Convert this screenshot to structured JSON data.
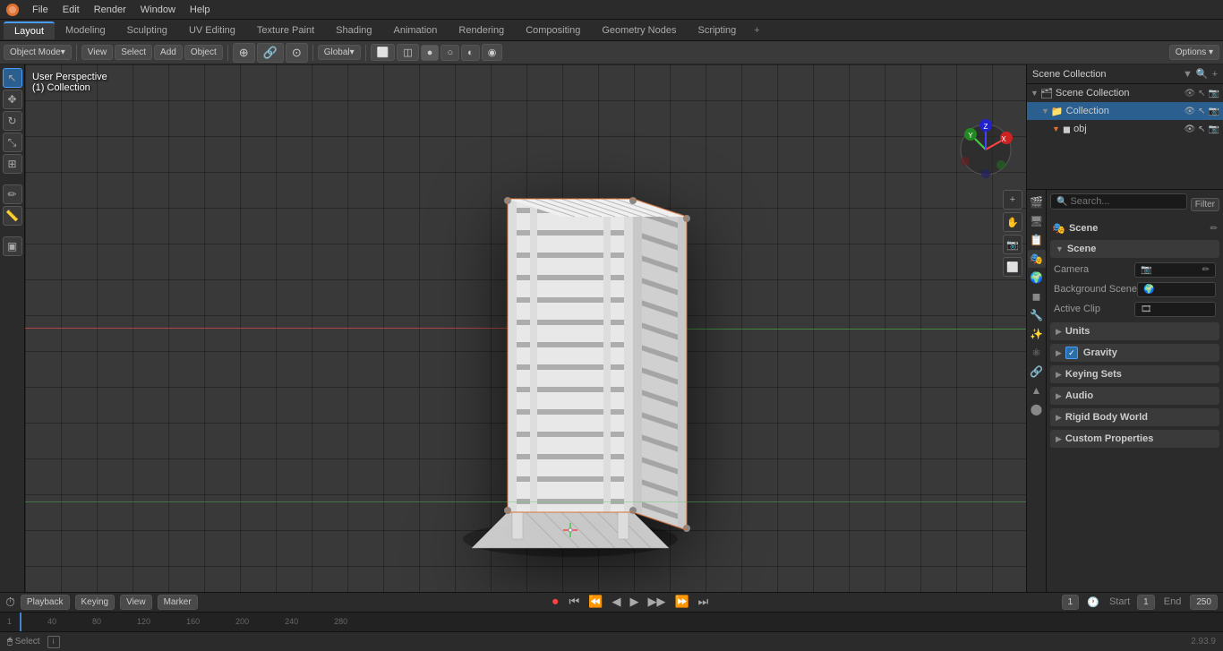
{
  "app": {
    "title": "Blender",
    "version": "2.93.9"
  },
  "top_menu": {
    "items": [
      "File",
      "Edit",
      "Render",
      "Window",
      "Help"
    ]
  },
  "tabs": {
    "items": [
      "Layout",
      "Modeling",
      "Sculpting",
      "UV Editing",
      "Texture Paint",
      "Shading",
      "Animation",
      "Rendering",
      "Compositing",
      "Geometry Nodes",
      "Scripting"
    ],
    "active": "Layout"
  },
  "viewport_header": {
    "mode": "Object Mode",
    "view": "View",
    "select": "Select",
    "add": "Add",
    "object": "Object",
    "transform": "Global",
    "options": "Options ▾"
  },
  "viewport_info": {
    "perspective": "User Perspective",
    "collection": "(1) Collection"
  },
  "timeline": {
    "playback": "Playback",
    "keying": "Keying",
    "view": "View",
    "marker": "Marker",
    "frame_current": "1",
    "start_label": "Start",
    "start_value": "1",
    "end_label": "End",
    "end_value": "250",
    "marks": [
      "1",
      "40",
      "80",
      "120",
      "160",
      "200",
      "240",
      "280"
    ]
  },
  "status_bar": {
    "select": "Select",
    "version": "2.93.9"
  },
  "outliner": {
    "header": "Scene Collection",
    "items": [
      {
        "label": "Scene Collection",
        "icon": "📁",
        "level": 0,
        "expanded": true
      },
      {
        "label": "Collection",
        "icon": "📁",
        "level": 1,
        "expanded": true
      },
      {
        "label": "obj",
        "icon": "▼",
        "level": 2,
        "expanded": false
      }
    ]
  },
  "properties": {
    "scene_name": "Scene",
    "search_placeholder": "Search...",
    "filter_label": "Filter",
    "sections": [
      {
        "id": "scene",
        "label": "Scene",
        "icon": "🎬",
        "expanded": true,
        "rows": [
          {
            "label": "Camera",
            "value": "",
            "type": "picker"
          },
          {
            "label": "Background Scene",
            "value": "",
            "type": "picker"
          },
          {
            "label": "Active Clip",
            "value": "",
            "type": "picker"
          }
        ]
      },
      {
        "id": "units",
        "label": "Units",
        "expanded": false
      },
      {
        "id": "gravity",
        "label": "Gravity",
        "expanded": false,
        "checkbox": true,
        "checkbox_checked": true
      },
      {
        "id": "keying_sets",
        "label": "Keying Sets",
        "expanded": false
      },
      {
        "id": "audio",
        "label": "Audio",
        "expanded": false
      },
      {
        "id": "rigid_body_world",
        "label": "Rigid Body World",
        "expanded": false
      },
      {
        "id": "custom_properties",
        "label": "Custom Properties",
        "expanded": false
      }
    ]
  },
  "left_tools": [
    {
      "icon": "↖",
      "name": "cursor-tool"
    },
    {
      "icon": "⊕",
      "name": "move-tool"
    },
    {
      "icon": "↗",
      "name": "transform-tool"
    },
    {
      "icon": "⟳",
      "name": "rotate-tool"
    },
    {
      "icon": "⤢",
      "name": "scale-tool"
    },
    {
      "icon": "✏",
      "name": "annotate-tool"
    },
    {
      "icon": "📐",
      "name": "measure-tool"
    },
    {
      "icon": "⬜",
      "name": "add-tool"
    }
  ],
  "viewport_right_icons": [
    {
      "icon": "⊕",
      "name": "zoom-icon"
    },
    {
      "icon": "✋",
      "name": "pan-icon"
    },
    {
      "icon": "📷",
      "name": "camera-icon"
    },
    {
      "icon": "🔲",
      "name": "frame-icon"
    }
  ],
  "colors": {
    "accent": "#4a9eff",
    "bg_dark": "#1a1a1a",
    "bg_medium": "#2b2b2b",
    "bg_light": "#3a3a3a",
    "active_tab": "#3d3d3d",
    "scene_icon": "#e07030",
    "checkbox_blue": "#2a6fa8"
  }
}
